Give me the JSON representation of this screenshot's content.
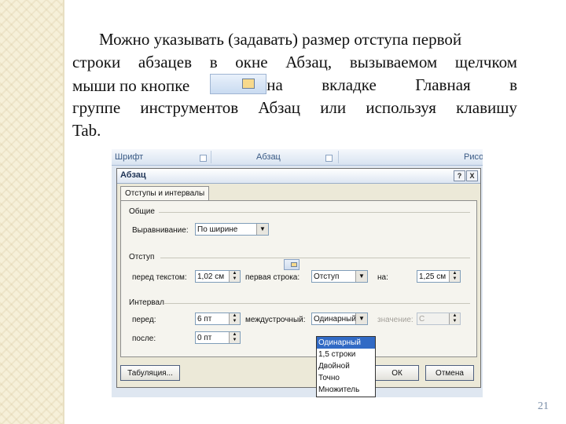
{
  "slide": {
    "lines": [
      "Можно указывать (задавать) размер отступа первой",
      "строки абзацев  в окне Абзац, вызываемом щелчком",
      "мыши по кнопке",
      "на вкладке Главная в",
      "группе инструментов Абзац или используя клавишу",
      "Tab."
    ],
    "page_number": "21"
  },
  "ribbon": {
    "font_group": "Шрифт",
    "paragraph_group": "Абзац",
    "drawing_group": "Рисо"
  },
  "dialog": {
    "title": "Абзац",
    "help_icon": "?",
    "close_icon": "X",
    "tab": "Отступы и интервалы",
    "general": {
      "legend": "Общие",
      "alignment_label": "Выравнивание:",
      "alignment_value": "По ширине"
    },
    "indent": {
      "legend": "Отступ",
      "before_text_label": "перед текстом:",
      "before_text_value": "1,02 см",
      "first_line_label": "первая строка:",
      "first_line_value": "Отступ",
      "on_label": "на:",
      "on_value": "1,25 см"
    },
    "spacing": {
      "legend": "Интервал",
      "before_label": "перед:",
      "before_value": "6 пт",
      "after_label": "после:",
      "after_value": "0 пт",
      "line_spacing_label": "междустрочный:",
      "line_spacing_value": "Одинарный",
      "value_label": "значение:",
      "value_value": "С"
    },
    "line_spacing_options": [
      "Одинарный",
      "1,5 строки",
      "Двойной",
      "Точно",
      "Множитель"
    ],
    "tabs_button": "Табуляция...",
    "ok_button": "ОК",
    "cancel_button": "Отмена"
  }
}
